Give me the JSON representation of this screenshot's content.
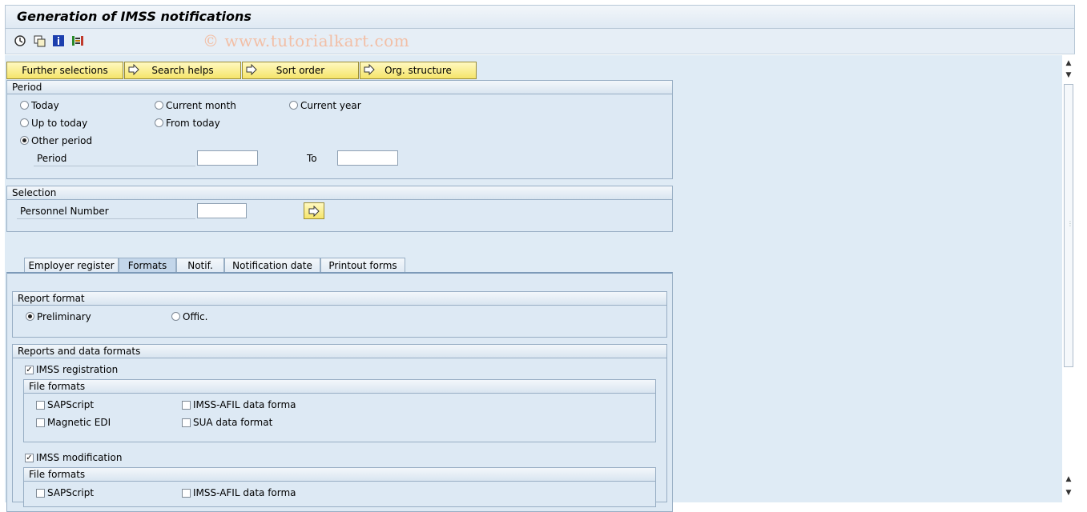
{
  "title": "Generation of IMSS notifications",
  "watermark": "© www.tutorialkart.com",
  "toolbar": {
    "icons": [
      "execute-icon",
      "save-variant-icon",
      "info-icon",
      "selection-options-icon"
    ]
  },
  "action_buttons": [
    "Further selections",
    "Search helps",
    "Sort order",
    "Org. structure"
  ],
  "period": {
    "heading": "Period",
    "options": [
      "Today",
      "Current month",
      "Current year",
      "Up to today",
      "From today",
      "Other period"
    ],
    "selected": "Other period",
    "period_label": "Period",
    "to_label": "To",
    "from_value": "",
    "to_value": ""
  },
  "selection": {
    "heading": "Selection",
    "personnel_label": "Personnel Number",
    "personnel_value": ""
  },
  "tabs": [
    "Employer register",
    "Formats",
    "Notif.",
    "Notification date",
    "Printout forms"
  ],
  "active_tab": "Formats",
  "report_format": {
    "heading": "Report format",
    "options": [
      "Preliminary",
      "Offic."
    ],
    "selected": "Preliminary"
  },
  "reports": {
    "heading": "Reports and data formats",
    "imss_registration": {
      "label": "IMSS registration",
      "checked": true
    },
    "file_formats_heading": "File formats",
    "file_formats_1": [
      {
        "label": "SAPScript",
        "checked": false
      },
      {
        "label": "IMSS-AFIL data forma",
        "checked": false
      },
      {
        "label": "Magnetic EDI",
        "checked": false
      },
      {
        "label": "SUA data format",
        "checked": false
      }
    ],
    "imss_modification": {
      "label": "IMSS modification",
      "checked": true
    },
    "file_formats_2": [
      {
        "label": "SAPScript",
        "checked": false
      },
      {
        "label": "IMSS-AFIL data forma",
        "checked": false
      }
    ]
  },
  "colors": {
    "panel": "#dfebf5",
    "button": "#f5e46a",
    "border": "#98aec4"
  }
}
